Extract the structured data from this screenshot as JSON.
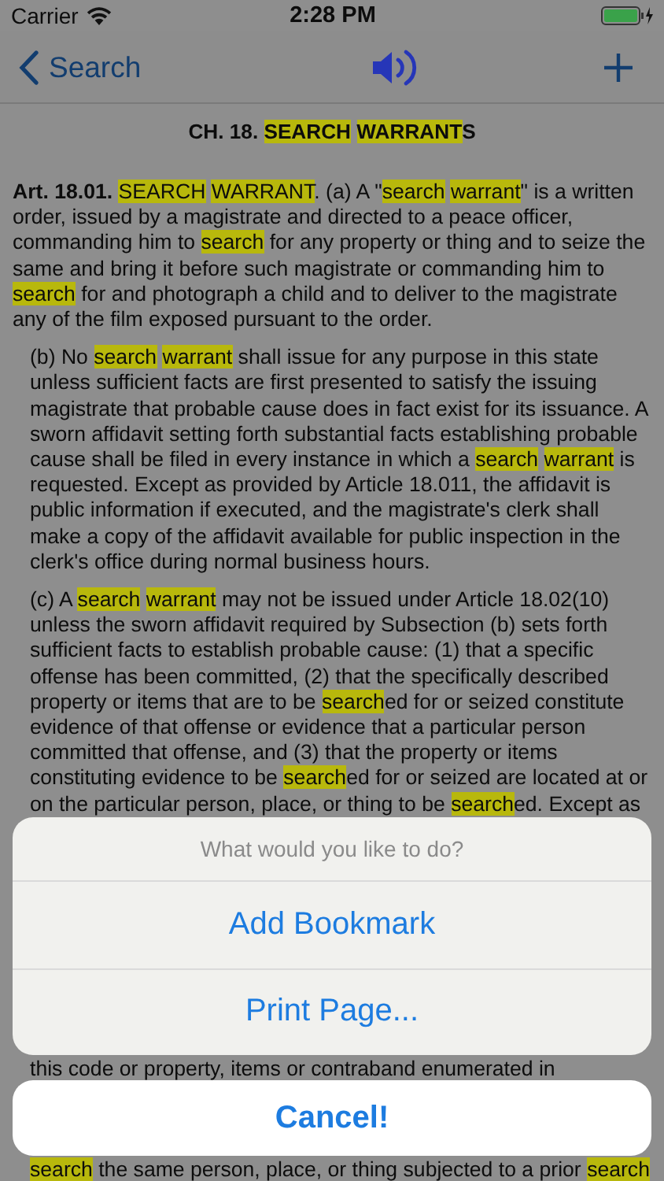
{
  "status_bar": {
    "carrier": "Carrier",
    "time": "2:28 PM"
  },
  "nav_bar": {
    "back_label": "Search"
  },
  "chapter_title": [
    {
      "text": "CH. 18. ",
      "highlight": false
    },
    {
      "text": "SEARCH ",
      "highlight": true
    },
    {
      "text": "WARRANT",
      "highlight": true
    },
    {
      "text": "S",
      "highlight": false
    }
  ],
  "paragraphs": [
    {
      "kind": "article",
      "runs": [
        {
          "text": "**Art. 18.01.** ",
          "highlight": false
        },
        {
          "text": "SEARCH ",
          "highlight": true
        },
        {
          "text": "WARRANT",
          "highlight": true
        },
        {
          "text": ". (a) A \"",
          "highlight": false
        },
        {
          "text": "search ",
          "highlight": true
        },
        {
          "text": "warrant",
          "highlight": true
        },
        {
          "text": "\" is a written order, issued by a magistrate and directed to a peace officer, commanding him to ",
          "highlight": false
        },
        {
          "text": "search",
          "highlight": true
        },
        {
          "text": " for any property or thing and to seize the same and bring it before such magistrate or commanding him to ",
          "highlight": false
        },
        {
          "text": "search",
          "highlight": true
        },
        {
          "text": " for and photograph a child and to deliver to the magistrate any of the film exposed pursuant to the order.",
          "highlight": false
        }
      ]
    },
    {
      "kind": "subsection",
      "runs": [
        {
          "text": "(b) No ",
          "highlight": false
        },
        {
          "text": "search ",
          "highlight": true
        },
        {
          "text": "warrant",
          "highlight": true
        },
        {
          "text": " shall issue for any purpose in this state unless sufficient facts are first presented to satisfy the issuing magistrate that probable cause does in fact exist for its issuance. A sworn affidavit setting forth substantial facts establishing probable cause shall be filed in every instance in which a ",
          "highlight": false
        },
        {
          "text": "search ",
          "highlight": true
        },
        {
          "text": "warrant",
          "highlight": true
        },
        {
          "text": " is requested. Except as provided by Article 18.011, the affidavit is public information if executed, and the magistrate's clerk shall make a copy of the affidavit available for public inspection in the clerk's office during normal business hours.",
          "highlight": false
        }
      ]
    },
    {
      "kind": "subsection",
      "runs": [
        {
          "text": "(c) A ",
          "highlight": false
        },
        {
          "text": "search ",
          "highlight": true
        },
        {
          "text": "warrant",
          "highlight": true
        },
        {
          "text": " may not be issued under Article 18.02(10) unless the sworn affidavit required by Subsection (b) sets forth sufficient facts to establish probable cause: (1) that a specific offense has been committed, (2) that the specifically described property or items that are to be ",
          "highlight": false
        },
        {
          "text": "search",
          "highlight": true
        },
        {
          "text": "ed for or seized constitute evidence of that offense or evidence that a particular person committed that offense, and (3) that the property or items constituting evidence to be ",
          "highlight": false
        },
        {
          "text": "search",
          "highlight": true
        },
        {
          "text": "ed for or seized are located at or on the particular person, place, or thing to be ",
          "highlight": false
        },
        {
          "text": "search",
          "highlight": true
        },
        {
          "text": "ed. Except as",
          "highlight": false
        }
      ]
    },
    {
      "kind": "fragment",
      "runs": [
        {
          "text": "this code or property, items or contraband enumerated in",
          "highlight": false
        }
      ]
    },
    {
      "kind": "fragment",
      "runs": [
        {
          "text": "search",
          "highlight": true
        },
        {
          "text": " the same person, place, or thing subjected to a prior ",
          "highlight": false
        },
        {
          "text": "search",
          "highlight": true
        }
      ]
    }
  ],
  "action_sheet": {
    "title": "What would you like to do?",
    "actions": [
      "Add Bookmark",
      "Print Page..."
    ],
    "cancel": "Cancel!"
  }
}
